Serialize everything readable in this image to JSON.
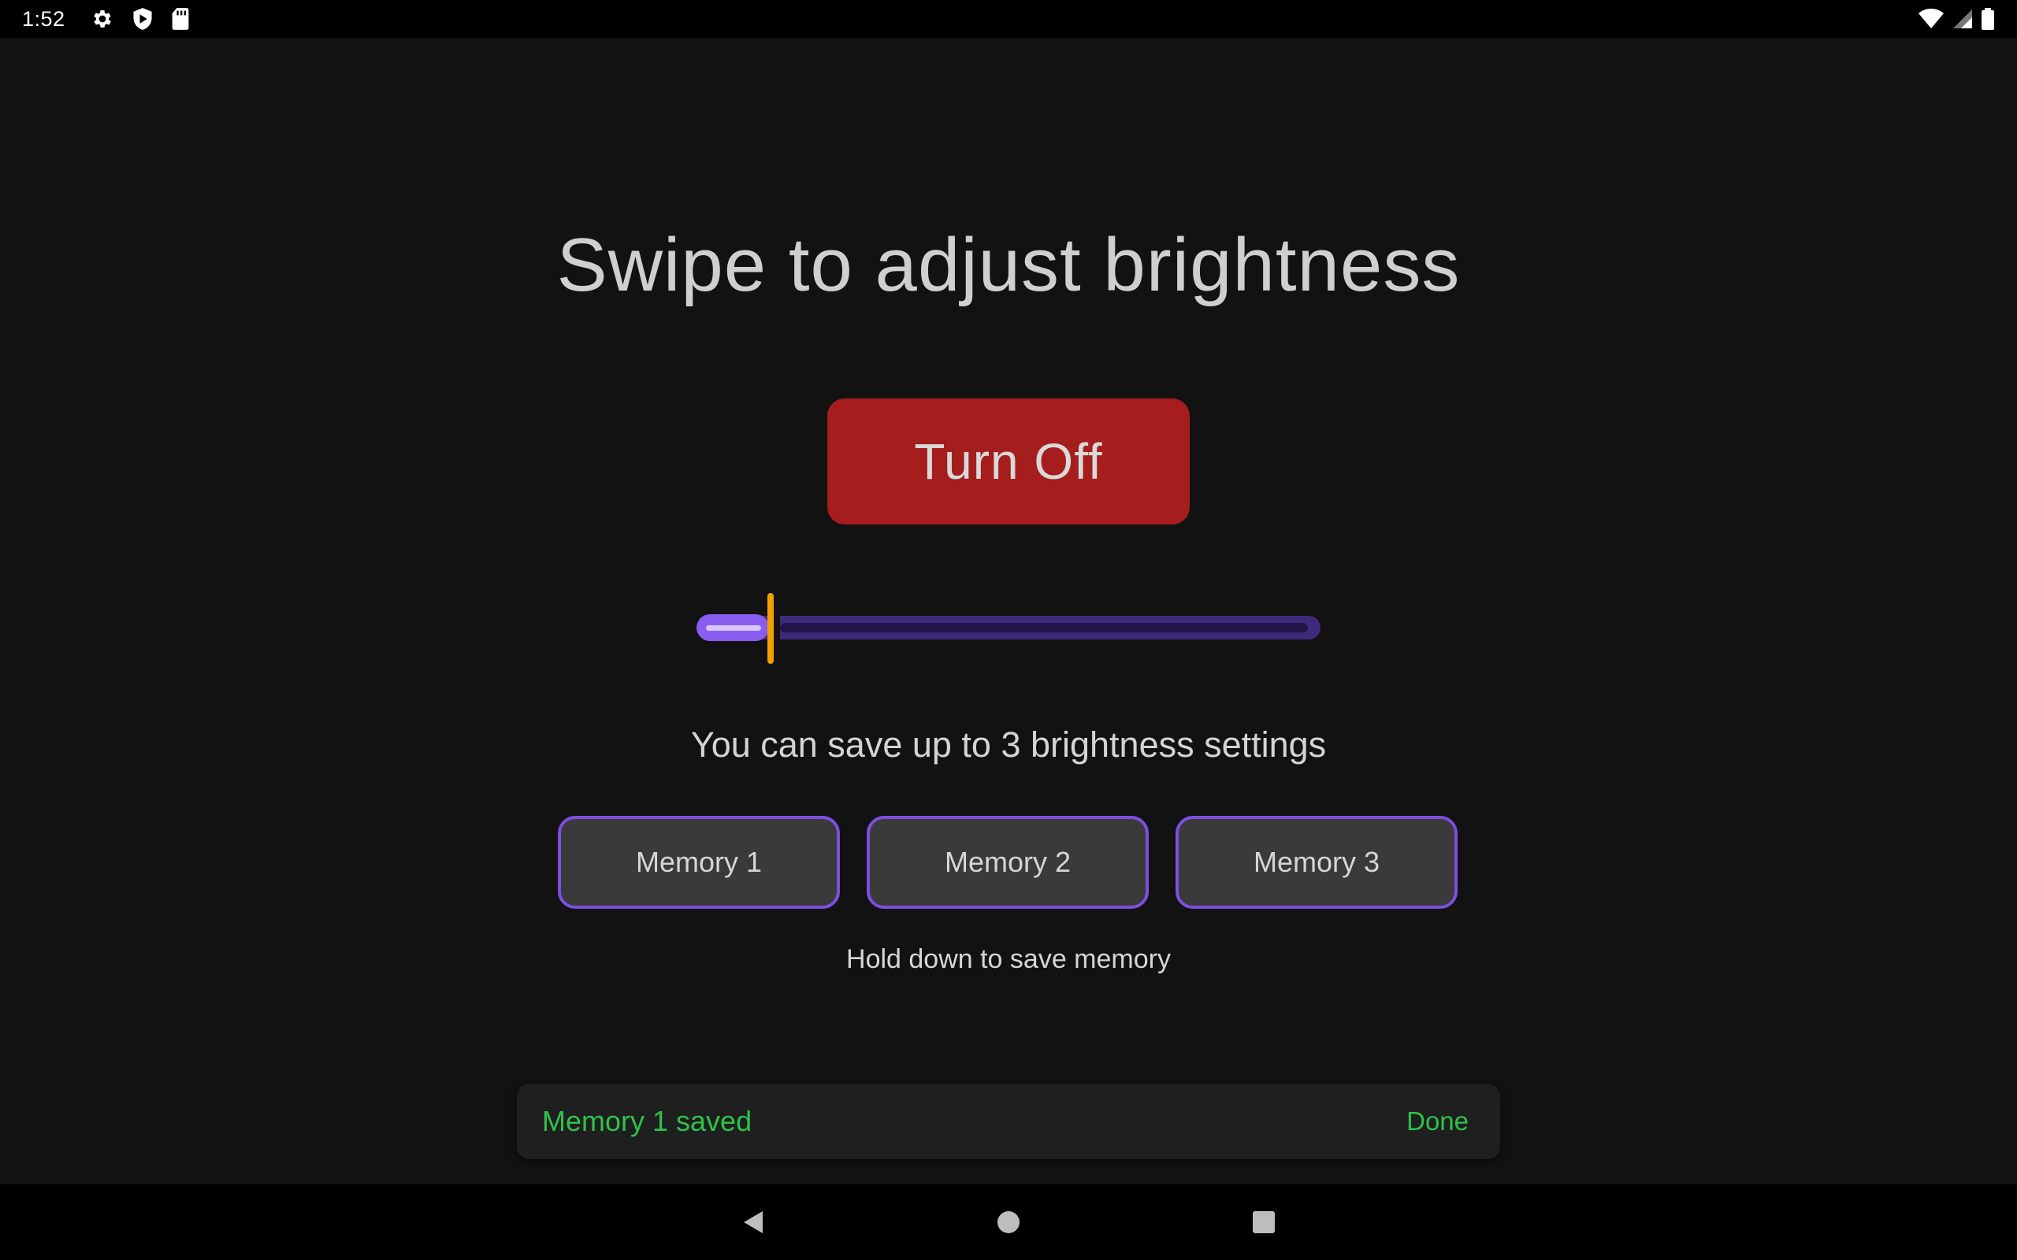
{
  "status_bar": {
    "time": "1:52",
    "left_icons": [
      "gear-icon",
      "shield-icon",
      "sd-card-icon"
    ],
    "right_icons": [
      "wifi-icon",
      "signal-icon",
      "battery-icon"
    ]
  },
  "main": {
    "title": "Swipe to adjust brightness",
    "turn_off_label": "Turn Off",
    "turn_off_color": "#a51d1d",
    "slider": {
      "value_fraction": 0.1,
      "accent": "#8a5cf0",
      "thumb_color": "#f0a000"
    },
    "subtitle": "You can save up to 3 brightness settings",
    "memory_buttons": [
      {
        "label": "Memory 1"
      },
      {
        "label": "Memory 2"
      },
      {
        "label": "Memory 3"
      }
    ],
    "hint": "Hold down to save memory"
  },
  "snackbar": {
    "message": "Memory 1 saved",
    "action": "Done",
    "color": "#2ec24a"
  },
  "nav_bar": {
    "buttons": [
      "back-icon",
      "home-icon",
      "recents-icon"
    ]
  }
}
